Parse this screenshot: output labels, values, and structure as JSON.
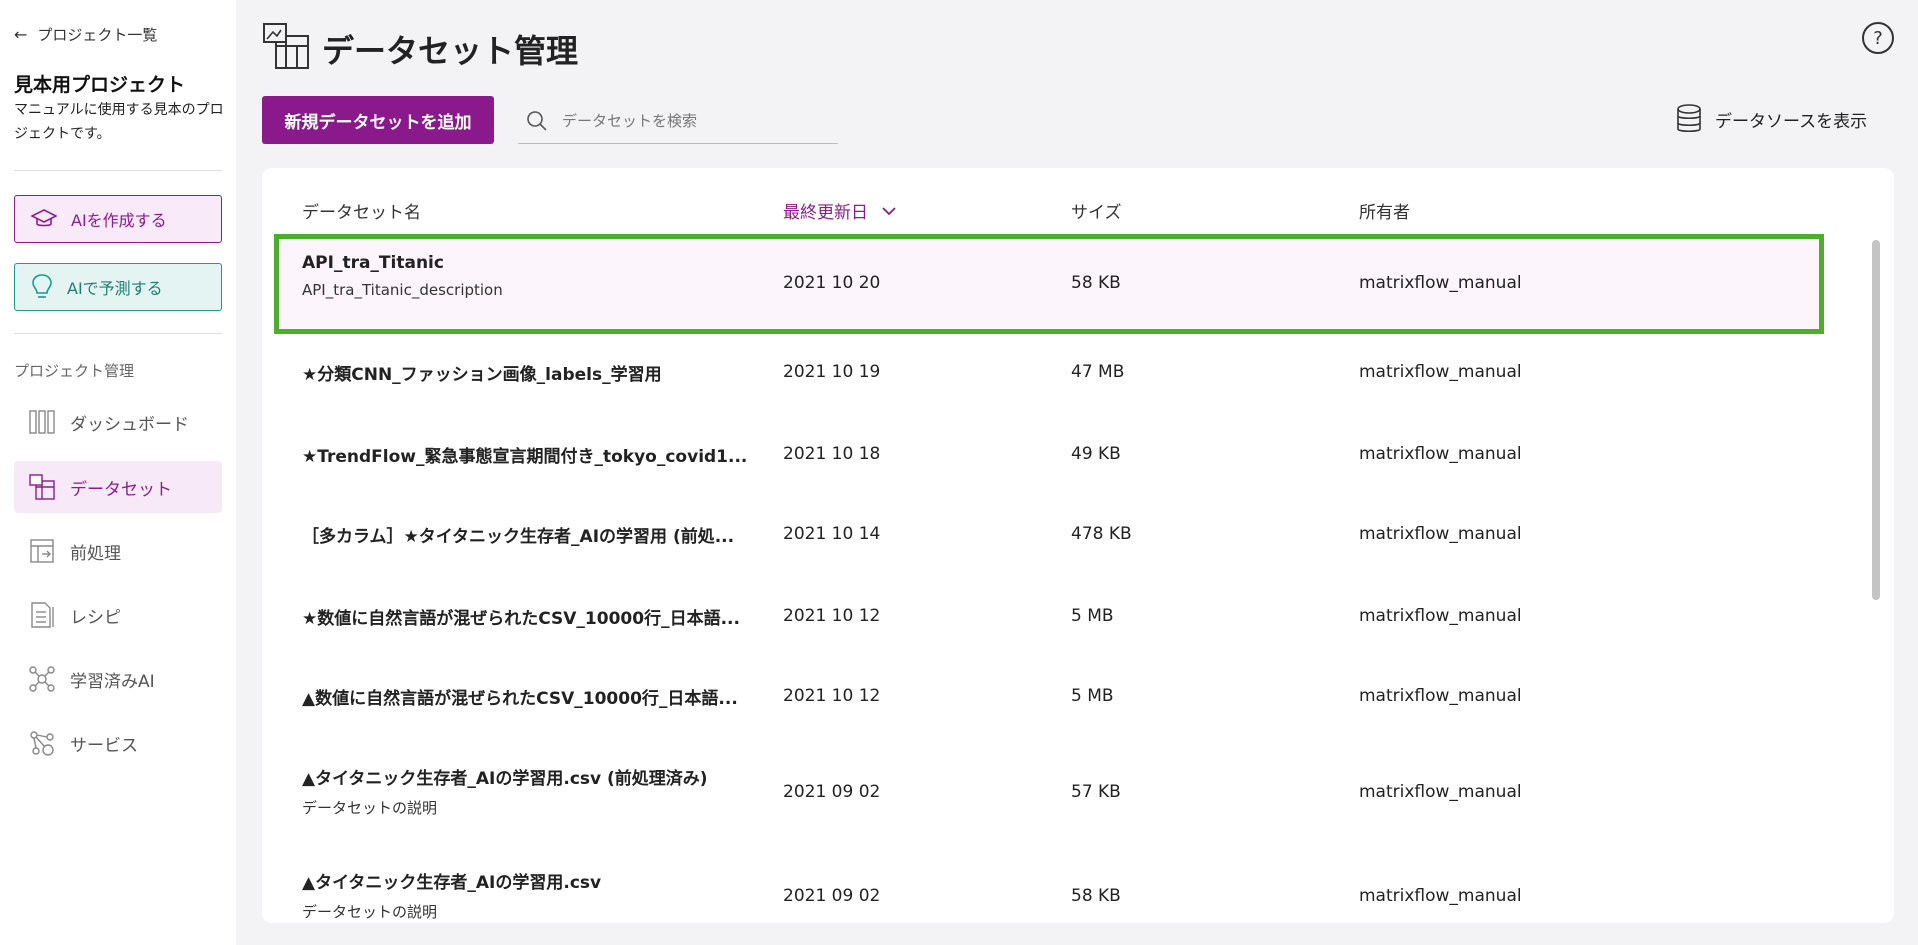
{
  "sidebar": {
    "back_label": "プロジェクト一覧",
    "project_name": "見本用プロジェクト",
    "project_description": "マニュアルに使用する見本のプロジェクトです。",
    "create_ai_label": "AIを作成する",
    "predict_ai_label": "AIで予測する",
    "section_label": "プロジェクト管理",
    "nav": [
      {
        "label": "ダッシュボード",
        "icon": "dashboard-icon"
      },
      {
        "label": "データセット",
        "icon": "dataset-icon",
        "active": true
      },
      {
        "label": "前処理",
        "icon": "preprocess-icon"
      },
      {
        "label": "レシピ",
        "icon": "recipe-icon"
      },
      {
        "label": "学習済みAI",
        "icon": "trained-ai-icon"
      },
      {
        "label": "サービス",
        "icon": "service-icon"
      }
    ]
  },
  "header": {
    "title": "データセット管理",
    "add_button": "新規データセットを追加",
    "search_placeholder": "データセットを検索",
    "datasource_label": "データソースを表示",
    "help": "?"
  },
  "table": {
    "columns": [
      "データセット名",
      "最終更新日",
      "サイズ",
      "所有者"
    ],
    "rows": [
      {
        "name": "API_tra_Titanic",
        "description": "API_tra_Titanic_description",
        "date": "2021 10 20",
        "size": "58 KB",
        "owner": "matrixflow_manual"
      },
      {
        "name": "★分類CNN_ファッション画像_labels_学習用",
        "description": "",
        "date": "2021 10 19",
        "size": "47 MB",
        "owner": "matrixflow_manual"
      },
      {
        "name": "★TrendFlow_緊急事態宣言期間付き_tokyo_covid1...",
        "description": "",
        "date": "2021 10 18",
        "size": "49 KB",
        "owner": "matrixflow_manual"
      },
      {
        "name": "［多カラム］★タイタニック生存者_AIの学習用 (前処...",
        "description": "",
        "date": "2021 10 14",
        "size": "478 KB",
        "owner": "matrixflow_manual"
      },
      {
        "name": "★数値に自然言語が混ぜられたCSV_10000行_日本語...",
        "description": "",
        "date": "2021 10 12",
        "size": "5 MB",
        "owner": "matrixflow_manual"
      },
      {
        "name": "▲数値に自然言語が混ぜられたCSV_10000行_日本語...",
        "description": "",
        "date": "2021 10 12",
        "size": "5 MB",
        "owner": "matrixflow_manual"
      },
      {
        "name": "▲タイタニック生存者_AIの学習用.csv (前処理済み)",
        "description": "データセットの説明",
        "date": "2021 09 02",
        "size": "57 KB",
        "owner": "matrixflow_manual"
      },
      {
        "name": "▲タイタニック生存者_AIの学習用.csv",
        "description": "データセットの説明",
        "date": "2021 09 02",
        "size": "58 KB",
        "owner": "matrixflow_manual"
      }
    ]
  },
  "colors": {
    "accent": "#8c1c8c",
    "teal": "#1f9a8e",
    "highlight_border": "#4caf2c"
  }
}
